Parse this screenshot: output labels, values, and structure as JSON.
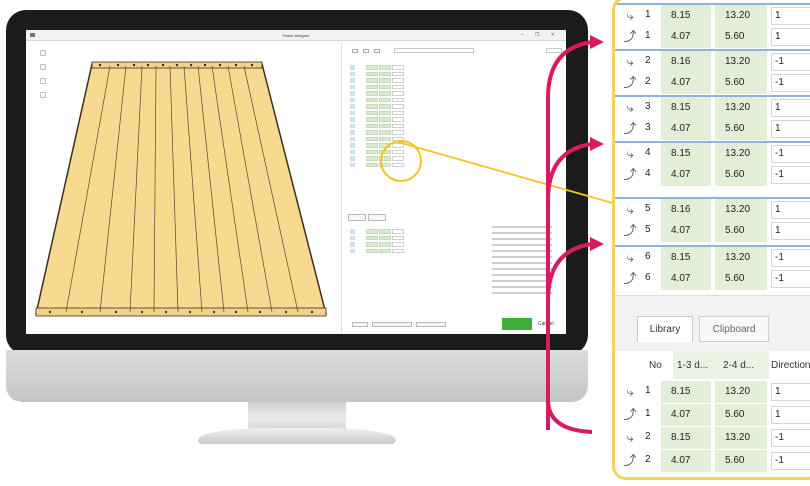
{
  "window": {
    "title": "Finish designer",
    "buttons": "– ❐ ✕"
  },
  "dialog": {
    "ok_label": "OK",
    "cancel_label": "Cancel"
  },
  "zoom_rows": [
    {
      "no": "1",
      "v1": "8.15",
      "v2": "13.20",
      "dir": "1"
    },
    {
      "no": "1",
      "v1": "4.07",
      "v2": "5.60",
      "dir": "1"
    },
    {
      "no": "2",
      "v1": "8.16",
      "v2": "13.20",
      "dir": "-1"
    },
    {
      "no": "2",
      "v1": "4.07",
      "v2": "5.60",
      "dir": "-1"
    },
    {
      "no": "3",
      "v1": "8.15",
      "v2": "13.20",
      "dir": "1"
    },
    {
      "no": "3",
      "v1": "4.07",
      "v2": "5.60",
      "dir": "1"
    },
    {
      "no": "4",
      "v1": "8.15",
      "v2": "13.20",
      "dir": "-1"
    },
    {
      "no": "4",
      "v1": "4.07",
      "v2": "5.60",
      "dir": "-1"
    },
    {
      "no": "5",
      "v1": "8.16",
      "v2": "13.20",
      "dir": "1"
    },
    {
      "no": "5",
      "v1": "4.07",
      "v2": "5.60",
      "dir": "1"
    },
    {
      "no": "6",
      "v1": "8.15",
      "v2": "13.20",
      "dir": "-1"
    },
    {
      "no": "6",
      "v1": "4.07",
      "v2": "5.60",
      "dir": "-1"
    }
  ],
  "tabs": {
    "library": "Library",
    "clipboard": "Clipboard"
  },
  "columns": {
    "no": "No",
    "d13": "1-3 d...",
    "d24": "2-4 d...",
    "direction": "Direction"
  },
  "library_rows": [
    {
      "no": "1",
      "v1": "8.15",
      "v2": "13.20",
      "dir": "1"
    },
    {
      "no": "1",
      "v1": "4.07",
      "v2": "5.60",
      "dir": "1"
    },
    {
      "no": "2",
      "v1": "8.15",
      "v2": "13.20",
      "dir": "-1"
    },
    {
      "no": "2",
      "v1": "4.07",
      "v2": "5.60",
      "dir": "-1"
    }
  ],
  "colors": {
    "monitor_bezel": "#1b1b1c",
    "panel_border": "#f5d25a",
    "connector": "#d81b60",
    "cell_green": "#e2efd6",
    "board_fill": "#f7d98f",
    "ok_green": "#3fae3f"
  },
  "icons": {
    "profile": "profile-icon",
    "row_selector": "row-selector-icon"
  }
}
